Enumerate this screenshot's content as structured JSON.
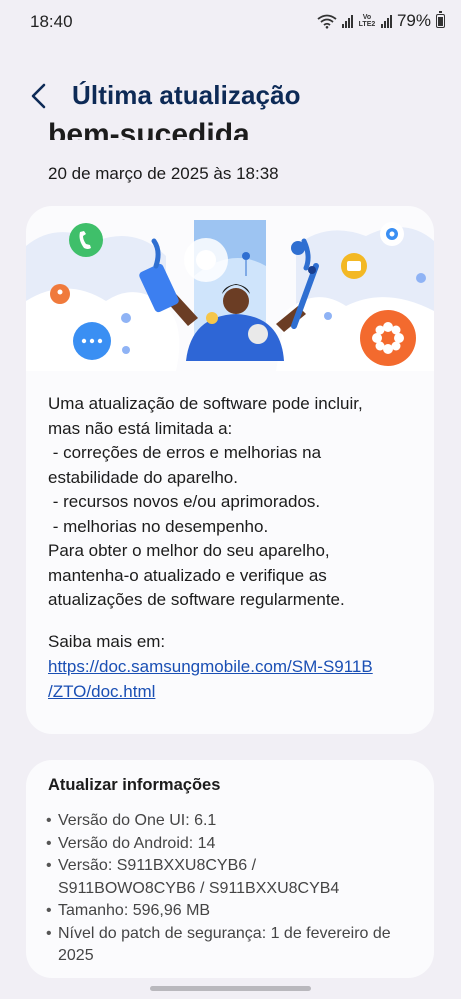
{
  "status_bar": {
    "time": "18:40",
    "network_label": "Vo LTE2",
    "battery": "79%"
  },
  "header": {
    "title": "Última atualização",
    "subtitle_partial": "bem-sucedida",
    "date": "20 de março de 2025 às 18:38"
  },
  "update_card": {
    "description_lines": [
      "Uma atualização de software pode incluir,",
      "mas não está limitada a:",
      " - correções de erros e melhorias na",
      "estabilidade do aparelho.",
      " - recursos novos e/ou aprimorados.",
      " - melhorias no desempenho.",
      "Para obter o melhor do seu aparelho,",
      "mantenha-o atualizado e verifique as",
      "atualizações de software regularmente."
    ],
    "learn_more_label": "Saiba mais em:",
    "link_line1": "https://doc.samsungmobile.com/SM-S911B",
    "link_line2": "/ZTO/doc.html"
  },
  "info_card": {
    "title": "Atualizar informações",
    "one_ui": "Versão do One UI: 6.1",
    "android": "Versão do Android: 14",
    "version_line1": "Versão: S911BXXU8CYB6 /",
    "version_line2": "S911BOWO8CYB6 / S911BXXU8CYB4",
    "size": "Tamanho: 596,96 MB",
    "patch_line1": "Nível do patch de segurança: 1 de fevereiro de",
    "patch_line2": "2025"
  },
  "colors": {
    "background": "#f1eff5",
    "title": "#0d2a56",
    "link": "#1a4fb4",
    "card": "#fbfbfd"
  },
  "icons": {
    "back": "chevron-left-icon",
    "wifi": "wifi-icon",
    "signal": "signal-icon",
    "battery": "battery-icon",
    "illustration": "software-update-illustration"
  }
}
